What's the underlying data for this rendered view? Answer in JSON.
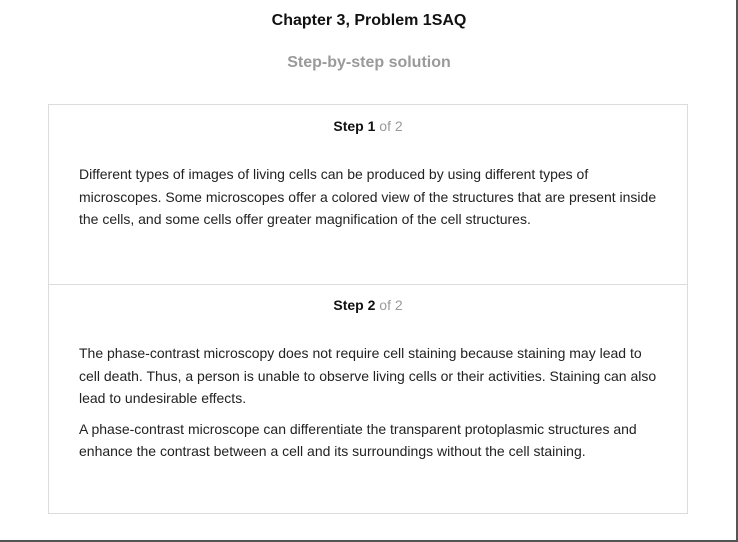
{
  "header": {
    "title": "Chapter 3, Problem 1SAQ",
    "subtitle": "Step-by-step solution"
  },
  "steps": [
    {
      "label": "Step",
      "number": "1",
      "of": "of 2",
      "paragraphs": [
        "Different types of images of living cells can be produced by using different types of microscopes. Some microscopes offer a colored view of the structures that are present inside the cells, and some cells offer greater magnification of the cell structures."
      ]
    },
    {
      "label": "Step",
      "number": "2",
      "of": "of 2",
      "paragraphs": [
        "The phase-contrast microscopy does not require cell staining because staining may lead to cell death. Thus, a person is unable to observe living cells or their activities. Staining can also lead to undesirable effects.",
        "A phase-contrast microscope can differentiate the transparent protoplasmic structures and enhance the contrast between a cell and its surroundings without the cell staining."
      ]
    }
  ]
}
